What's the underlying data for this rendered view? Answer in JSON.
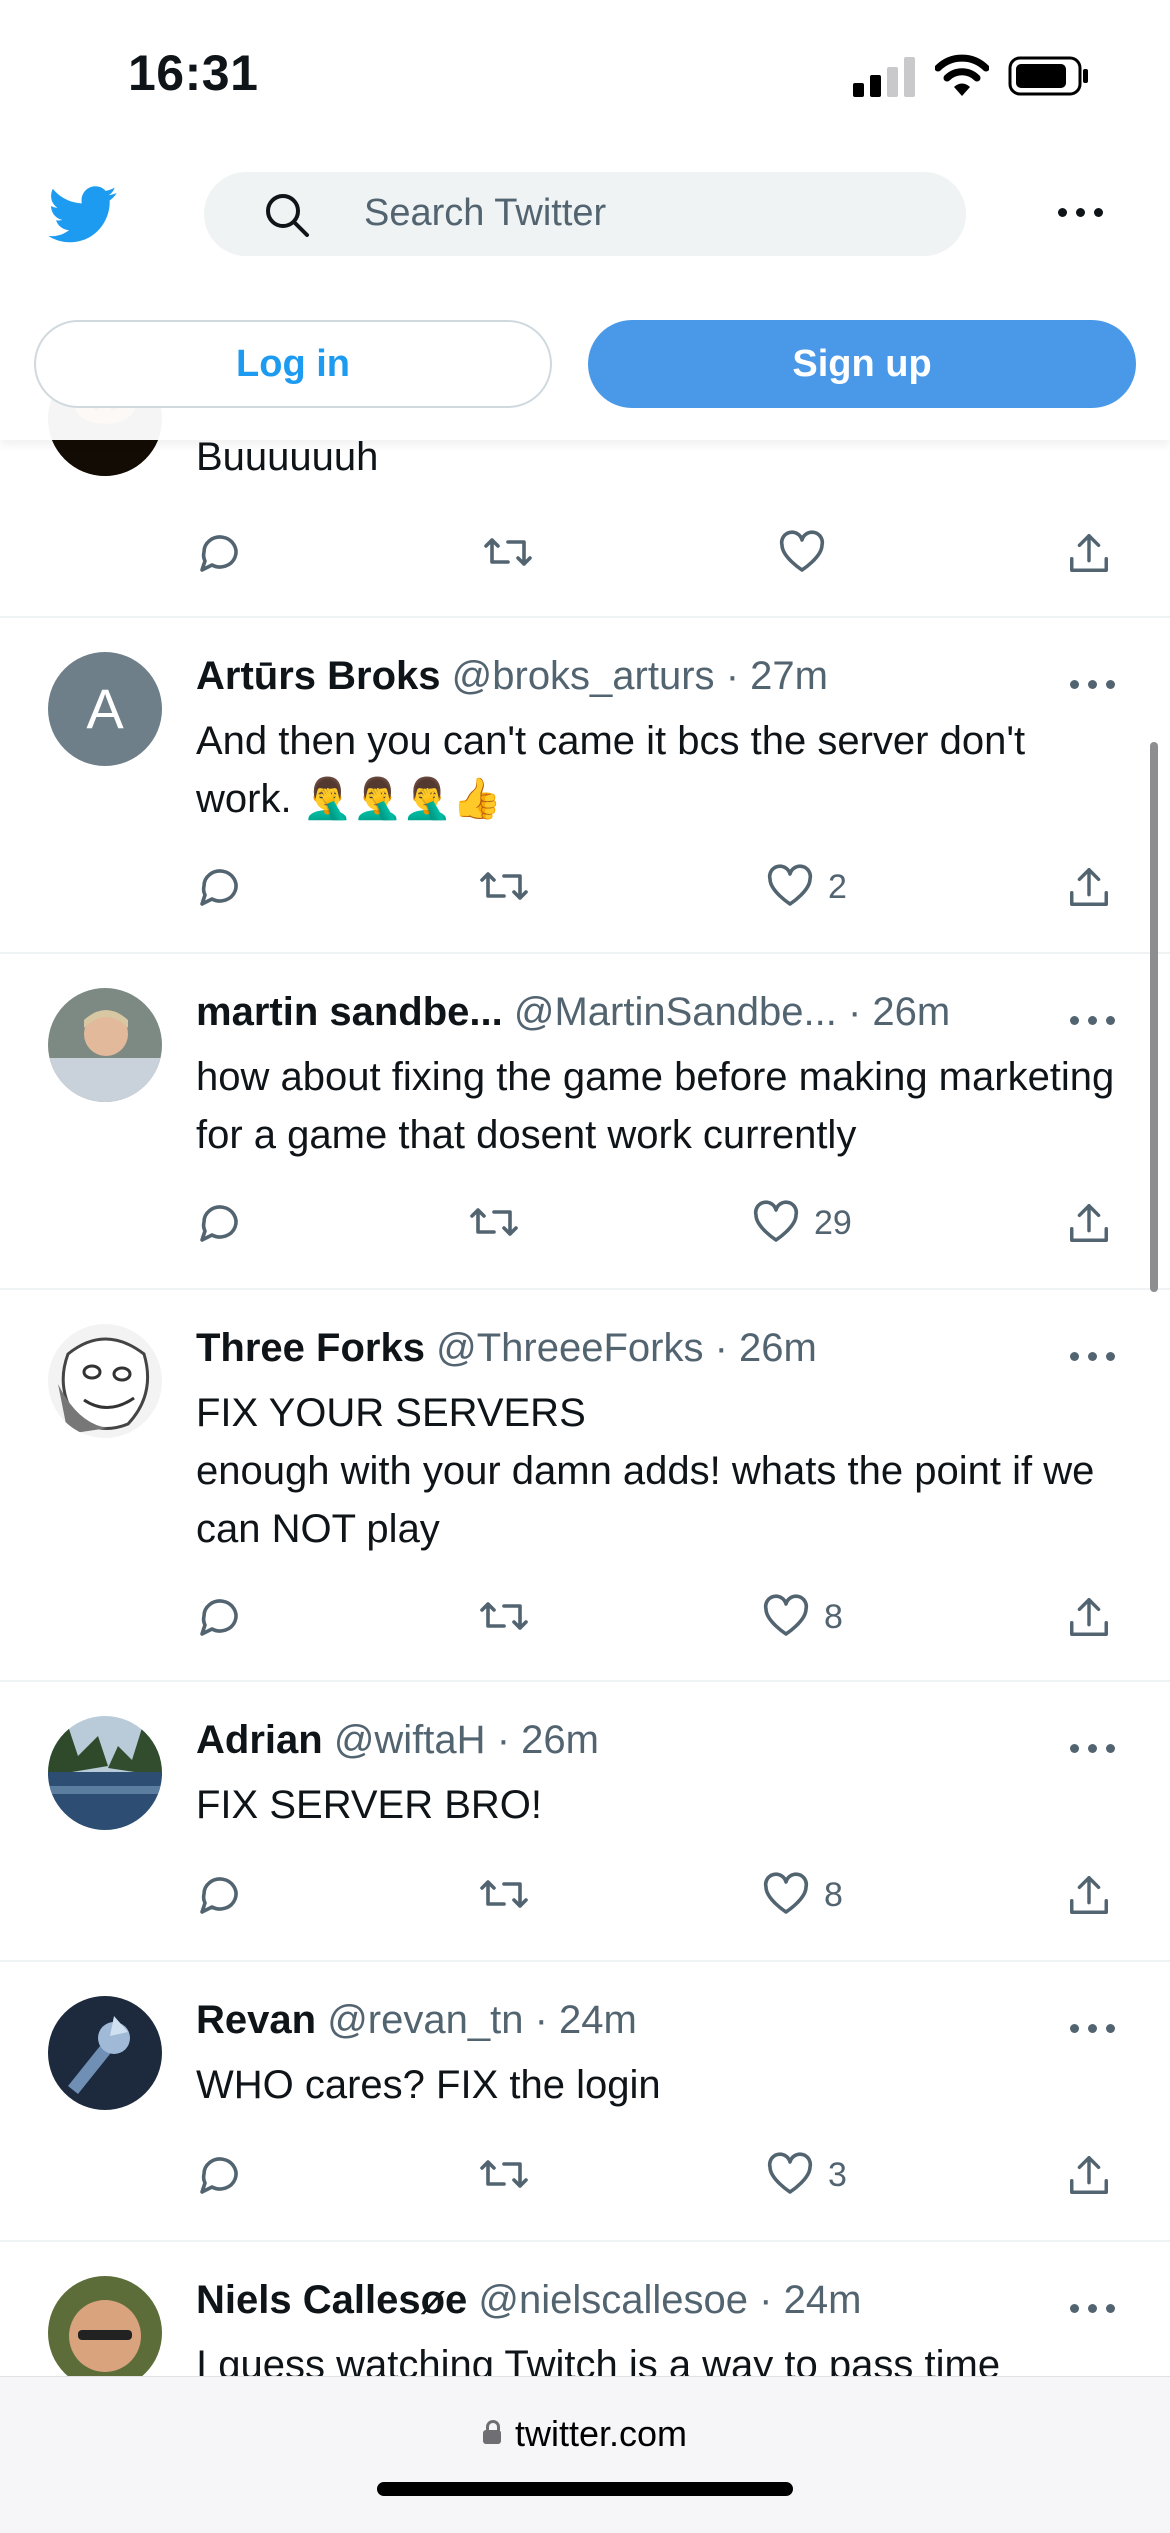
{
  "status_bar": {
    "time": "16:31"
  },
  "header": {
    "search_placeholder": "Search Twitter",
    "login_label": "Log in",
    "signup_label": "Sign up"
  },
  "tweets": [
    {
      "name": "",
      "handle": "",
      "time": "",
      "text": "Buuuuuuh",
      "likes": "",
      "avatar": "mushroom-avatar"
    },
    {
      "name": "Artūrs Broks",
      "handle": "@broks_arturs",
      "time": "· 27m",
      "text": "And then you can't came it bcs the server don't work. 🤦‍♂️🤦‍♂️🤦‍♂️👍",
      "likes": "2",
      "avatar_letter": "A"
    },
    {
      "name": "martin sandbe...",
      "handle": "@MartinSandbe...",
      "time": "· 26m",
      "text": "how about fixing the game before making marketing for a game that dosent work currently",
      "likes": "29"
    },
    {
      "name": "Three Forks",
      "handle": "@ThreeeForks",
      "time": "· 26m",
      "text": "FIX YOUR SERVERS\nenough with your damn adds! whats the point if we can NOT play",
      "likes": "8"
    },
    {
      "name": "Adrian",
      "handle": "@wiftaH",
      "time": "· 26m",
      "text": "FIX SERVER BRO!",
      "likes": "8"
    },
    {
      "name": "Revan",
      "handle": "@revan_tn",
      "time": "· 24m",
      "text": "WHO cares? FIX the login",
      "likes": "3"
    },
    {
      "name": "Niels Callesøe",
      "handle": "@nielscallesoe",
      "time": "· 24m",
      "text": "I guess watching Twitch is a way to pass time",
      "likes": ""
    }
  ],
  "browser": {
    "url": "twitter.com"
  },
  "colors": {
    "accent": "#1d9bf0",
    "signup_bg": "#4a99e9",
    "muted": "#536471"
  }
}
